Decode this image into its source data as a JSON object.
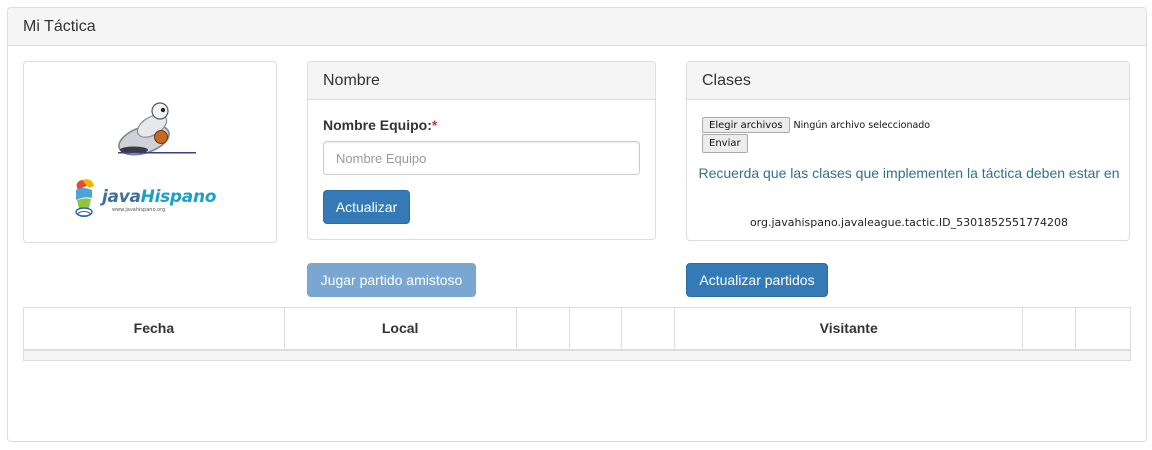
{
  "outer": {
    "title": "Mi Táctica"
  },
  "logo": {
    "brand_main": "java",
    "brand_highlight": "Hispano",
    "url": "www.javahispano.org"
  },
  "nombre_panel": {
    "title": "Nombre",
    "field_label": "Nombre Equipo:",
    "required_mark": "*",
    "input_placeholder": "Nombre Equipo",
    "input_value": "",
    "submit_label": "Actualizar"
  },
  "clases_panel": {
    "title": "Clases",
    "file_button_label": "Elegir archivos",
    "file_status": "Ningún archivo seleccionado",
    "send_label": "Enviar",
    "info_text": "Recuerda que las clases que implementen la táctica deben estar en",
    "class_package": "org.javahispano.javaleague.tactic.ID_5301852551774208"
  },
  "actions": {
    "friendly_label": "Jugar partido amistoso",
    "update_matches_label": "Actualizar partidos"
  },
  "table": {
    "headers": [
      "Fecha",
      "Local",
      "",
      "",
      "",
      "Visitante",
      "",
      ""
    ]
  },
  "colors": {
    "primary": "#337ab7",
    "primary_disabled": "#7aa6d2",
    "info_text": "#31708f",
    "required": "#a94442",
    "panel_heading_bg": "#f5f5f5",
    "border": "#dddddd"
  }
}
